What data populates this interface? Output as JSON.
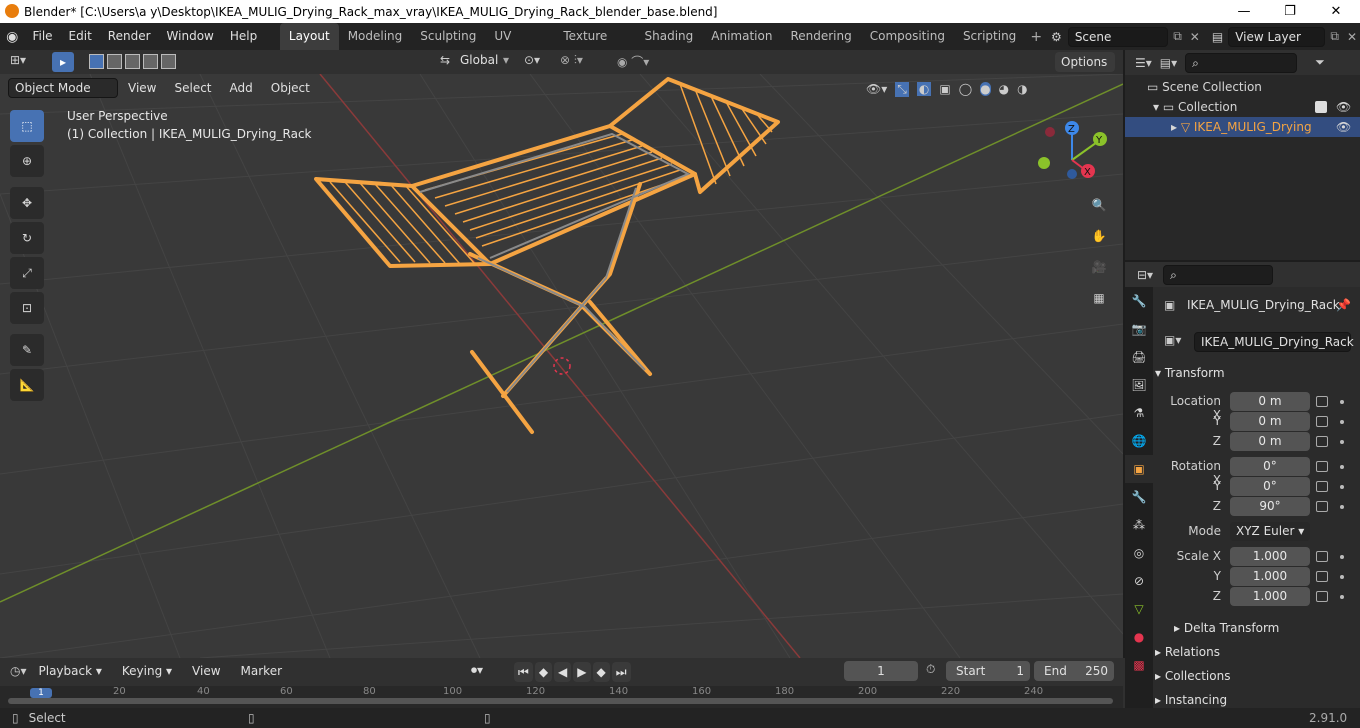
{
  "window": {
    "title": "Blender* [C:\\Users\\a y\\Desktop\\IKEA_MULIG_Drying_Rack_max_vray\\IKEA_MULIG_Drying_Rack_blender_base.blend]",
    "minimize": "—",
    "maximize": "❐",
    "close": "✕"
  },
  "menus": [
    "File",
    "Edit",
    "Render",
    "Window",
    "Help"
  ],
  "workspaces": [
    "Layout",
    "Modeling",
    "Sculpting",
    "UV Editing",
    "Texture Paint",
    "Shading",
    "Animation",
    "Rendering",
    "Compositing",
    "Scripting"
  ],
  "scene": {
    "name": "Scene",
    "view_layer": "View Layer"
  },
  "viewport": {
    "orientation": "Global",
    "options": "Options",
    "mode": "Object Mode",
    "menus": [
      "View",
      "Select",
      "Add",
      "Object"
    ],
    "perspective_label": "User Perspective",
    "collection_label": "(1) Collection | IKEA_MULIG_Drying_Rack",
    "gizmo": {
      "x": "X",
      "y": "Y",
      "z": "Z"
    }
  },
  "outliner": {
    "scene_collection": "Scene Collection",
    "collection": "Collection",
    "object": "IKEA_MULIG_Drying"
  },
  "properties": {
    "object_name": "IKEA_MULIG_Drying_Rack",
    "data_name": "IKEA_MULIG_Drying_Rack",
    "transform_title": "Transform",
    "location_label": "Location X",
    "loc_x": "0 m",
    "loc_y": "0 m",
    "loc_z": "0 m",
    "rotation_label": "Rotation X",
    "rot_x": "0°",
    "rot_y": "0°",
    "rot_z": "90°",
    "mode_label": "Mode",
    "mode_value": "XYZ Euler",
    "scale_label": "Scale X",
    "scale_x": "1.000",
    "scale_y": "1.000",
    "scale_z": "1.000",
    "y_label": "Y",
    "z_label": "Z",
    "delta": "Delta Transform",
    "relations": "Relations",
    "collections": "Collections",
    "instancing": "Instancing"
  },
  "timeline": {
    "menus": [
      "Playback",
      "Keying",
      "View",
      "Marker"
    ],
    "current_frame": "1",
    "start_label": "Start",
    "start": "1",
    "end_label": "End",
    "end": "250",
    "ruler": [
      "1",
      "20",
      "40",
      "60",
      "80",
      "100",
      "120",
      "140",
      "160",
      "180",
      "200",
      "220",
      "240"
    ]
  },
  "status": {
    "select": "Select",
    "version": "2.91.0"
  },
  "colors": {
    "accent": "#4772b3",
    "selection": "#f5a442",
    "x_axis": "#e4354f",
    "y_axis": "#8bc22a",
    "z_axis": "#3d88e9"
  }
}
